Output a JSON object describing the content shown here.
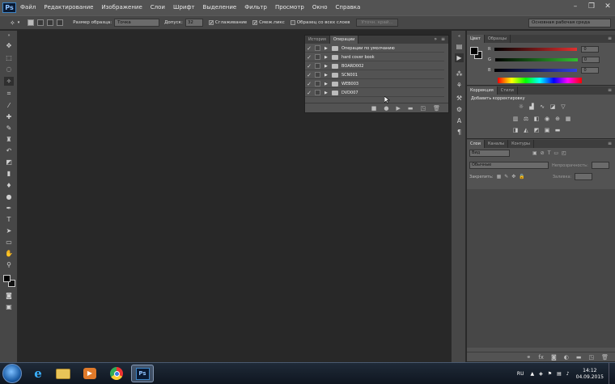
{
  "app": {
    "logo": "Ps"
  },
  "menu": [
    "Файл",
    "Редактирование",
    "Изображение",
    "Слои",
    "Шрифт",
    "Выделение",
    "Фильтр",
    "Просмотр",
    "Окно",
    "Справка"
  ],
  "window_controls": {
    "minimize": "–",
    "restore": "❐",
    "close": "✕"
  },
  "options": {
    "sample_size_label": "Размер образца:",
    "sample_size_value": "Точка",
    "tolerance_label": "Допуск:",
    "tolerance_value": "32",
    "antialias_label": "Сглаживание",
    "contiguous_label": "Смеж.пикс",
    "all_layers_label": "Образец со всех слоев",
    "refine_edge_label": "Уточн. край...",
    "workspace": "Основная рабочая среда"
  },
  "actions_panel": {
    "tabs": [
      "История",
      "Операции"
    ],
    "active_tab": 1,
    "rows": [
      "Операции по умолчанию",
      "hard cover book",
      "BOARD002",
      "SCN001",
      "WEB003",
      "DVD007"
    ]
  },
  "color_panel": {
    "tabs": [
      "Цвет",
      "Образцы"
    ],
    "channels": [
      {
        "label": "R",
        "value": "0",
        "color": "#e03030"
      },
      {
        "label": "G",
        "value": "0",
        "color": "#30c030"
      },
      {
        "label": "B",
        "value": "0",
        "color": "#3040e0"
      }
    ]
  },
  "adjustments_panel": {
    "tabs": [
      "Коррекция",
      "Стили"
    ],
    "title": "Добавить корректировку"
  },
  "layers_panel": {
    "tabs": [
      "Слои",
      "Каналы",
      "Контуры"
    ],
    "filter_value": "Вид",
    "blend_mode": "Обычные",
    "opacity_label": "Непрозрачность:",
    "lock_label": "Закрепить:",
    "fill_label": "Заливка:"
  },
  "taskbar": {
    "language": "RU",
    "time": "14:12",
    "date": "04.09.2015"
  }
}
